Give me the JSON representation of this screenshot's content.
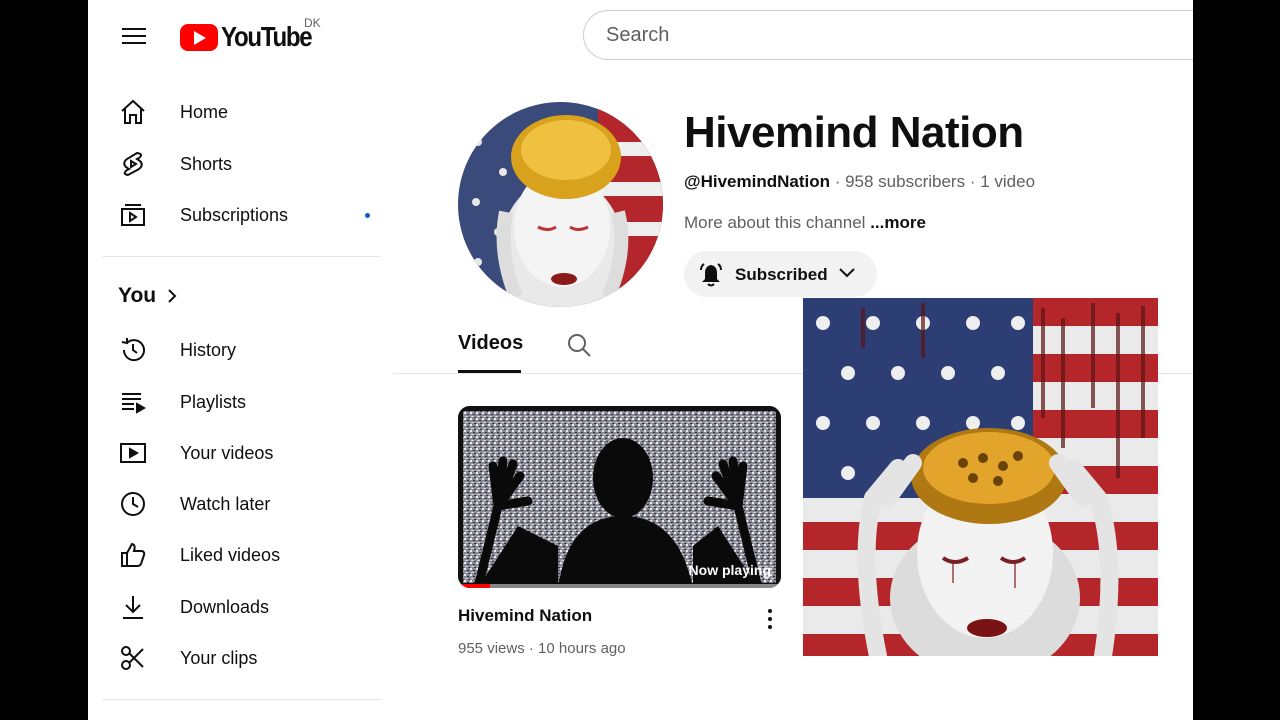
{
  "header": {
    "logo_text": "YouTube",
    "country_code": "DK",
    "search_placeholder": "Search"
  },
  "sidebar": {
    "main_items": [
      {
        "label": "Home",
        "icon": "home-icon"
      },
      {
        "label": "Shorts",
        "icon": "shorts-icon"
      },
      {
        "label": "Subscriptions",
        "icon": "subscriptions-icon"
      }
    ],
    "you_label": "You",
    "you_items": [
      {
        "label": "History",
        "icon": "history-icon"
      },
      {
        "label": "Playlists",
        "icon": "playlists-icon"
      },
      {
        "label": "Your videos",
        "icon": "your-videos-icon"
      },
      {
        "label": "Watch later",
        "icon": "watch-later-icon"
      },
      {
        "label": "Liked videos",
        "icon": "thumbs-up-icon"
      },
      {
        "label": "Downloads",
        "icon": "download-icon"
      },
      {
        "label": "Your clips",
        "icon": "scissors-icon"
      }
    ]
  },
  "channel": {
    "name": "Hivemind Nation",
    "handle": "@HivemindNation",
    "subscribers": "958 subscribers",
    "video_count": "1 video",
    "separator": " · ",
    "about_text": "More about this channel",
    "more_label": "...more",
    "subscribe_label": "Subscribed"
  },
  "tabs": {
    "videos_label": "Videos"
  },
  "video": {
    "title": "Hivemind Nation",
    "views": "955 views",
    "age": "10 hours ago",
    "meta_separator": " · ",
    "now_playing": "Now playing",
    "progress_fraction": 0.1
  },
  "colors": {
    "brand_red": "#ff0000",
    "text_primary": "#0f0f0f",
    "text_secondary": "#606060",
    "notification_dot": "#065fd4"
  }
}
